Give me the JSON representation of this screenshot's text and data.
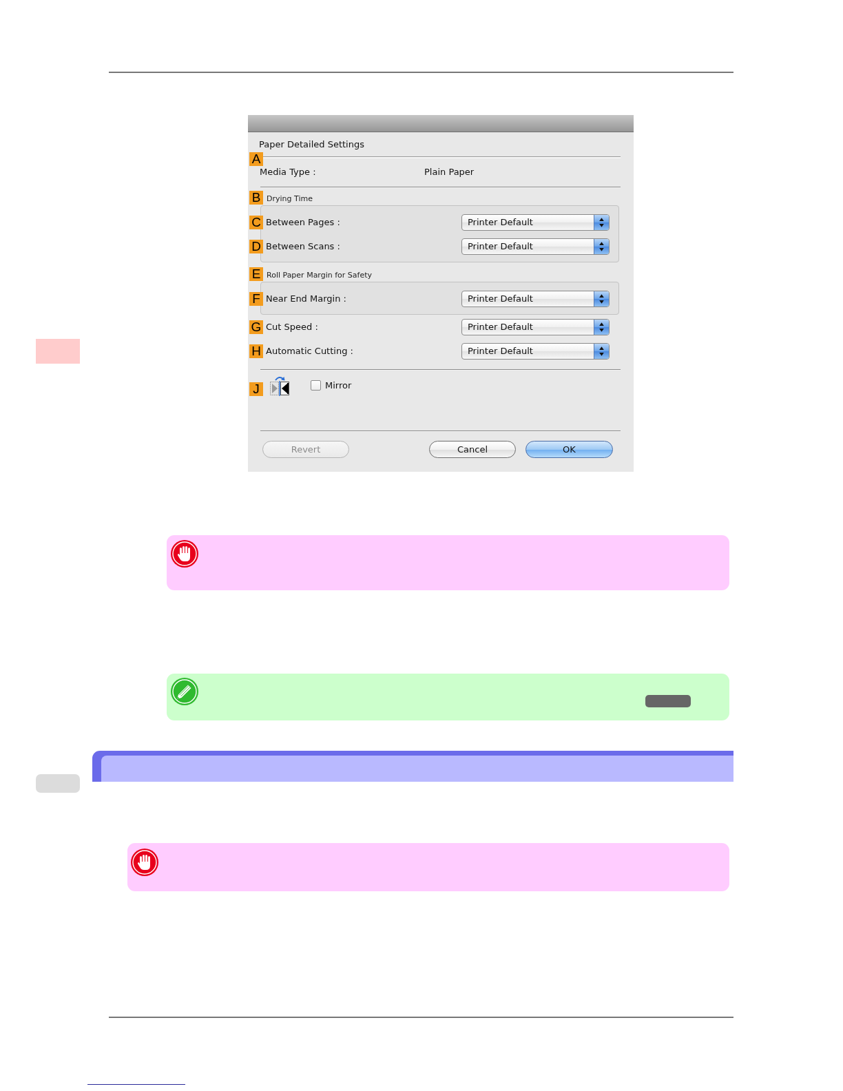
{
  "dialog": {
    "title": "Paper Detailed Settings",
    "media_type": {
      "marker": "A",
      "label": "Media Type :",
      "value": "Plain Paper"
    },
    "settings": [
      {
        "kind": "group",
        "marker": "B",
        "title": "Drying Time",
        "items": [
          {
            "marker": "C",
            "label": "Between Pages :",
            "value": "Printer Default"
          },
          {
            "marker": "D",
            "label": "Between Scans :",
            "value": "Printer Default"
          }
        ]
      },
      {
        "kind": "group",
        "marker": "E",
        "title": "Roll Paper Margin for Safety",
        "items": [
          {
            "marker": "F",
            "label": "Near End Margin :",
            "value": "Printer Default"
          }
        ]
      },
      {
        "kind": "select",
        "marker": "G",
        "label": "Cut Speed :",
        "value": "Printer Default"
      },
      {
        "kind": "select",
        "marker": "H",
        "label": "Automatic Cutting :",
        "value": "Printer Default"
      }
    ],
    "mirror": {
      "marker": "J",
      "label": "Mirror",
      "checked": false
    },
    "buttons": [
      {
        "label": "Revert",
        "disabled": true,
        "default": false
      },
      {
        "label": "Cancel",
        "disabled": false,
        "default": false
      },
      {
        "label": "OK",
        "disabled": false,
        "default": true
      }
    ]
  },
  "content": [
    {
      "kind": "important_note"
    },
    {
      "kind": "tip_note",
      "key_badge": true
    },
    {
      "kind": "section_heading"
    },
    {
      "kind": "important_note"
    }
  ]
}
